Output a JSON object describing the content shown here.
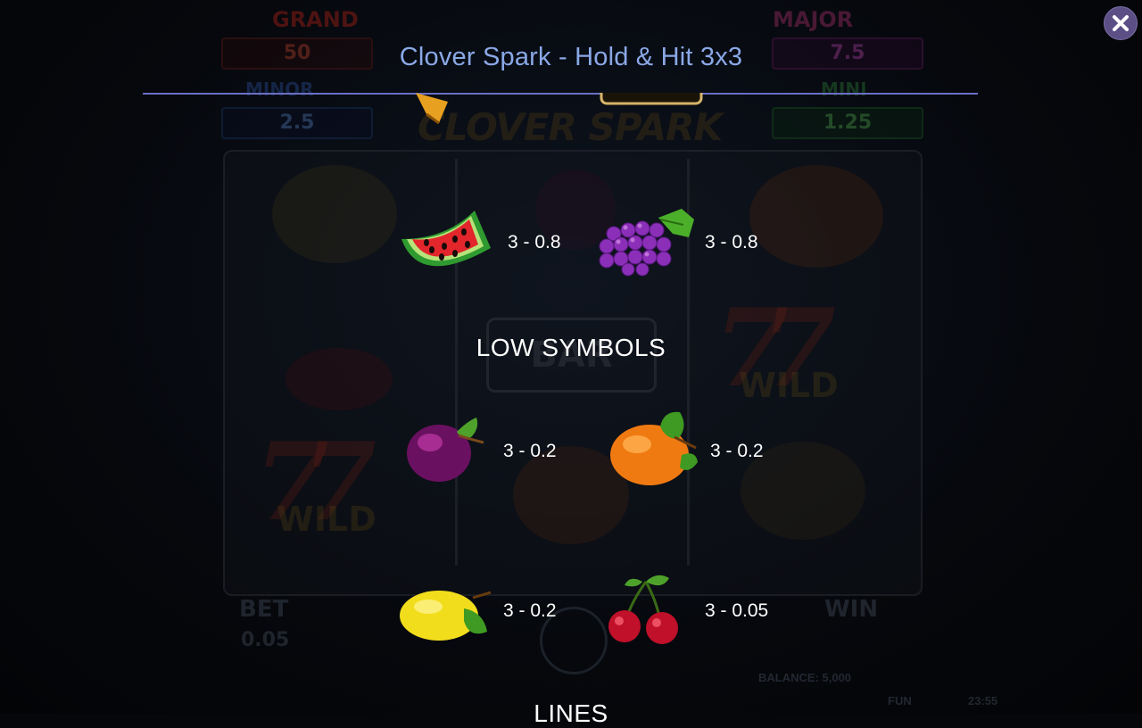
{
  "game_title": "Clover Spark - Hold & Hit 3x3",
  "close_icon": "close-icon",
  "sections": {
    "low_symbols_heading": "LOW SYMBOLS",
    "lines_heading": "LINES"
  },
  "mid_symbols": [
    {
      "icon": "watermelon-icon",
      "payout": "3 - 0.8"
    },
    {
      "icon": "grapes-icon",
      "payout": "3 - 0.8"
    }
  ],
  "low_symbols": [
    {
      "icon": "plum-icon",
      "payout": "3 - 0.2"
    },
    {
      "icon": "orange-icon",
      "payout": "3 - 0.2"
    },
    {
      "icon": "lemon-icon",
      "payout": "3 - 0.2"
    },
    {
      "icon": "cherry-icon",
      "payout": "3 - 0.05"
    }
  ],
  "background": {
    "jackpots": [
      {
        "label": "GRAND",
        "value": "50"
      },
      {
        "label": "MAJOR",
        "value": "7.5"
      },
      {
        "label": "MINOR",
        "value": "2.5"
      },
      {
        "label": "MINI",
        "value": "1.25"
      }
    ],
    "logo": "CLOVER SPARK",
    "bet_label": "BET",
    "bet_value": "0.05",
    "win_label": "WIN",
    "balance": "BALANCE: 5,000",
    "mode": "FUN",
    "clock": "23:55"
  },
  "colors": {
    "title": "#8aa8e6",
    "rule": "#6a6fc4",
    "close_bg": "#5b4f86"
  }
}
